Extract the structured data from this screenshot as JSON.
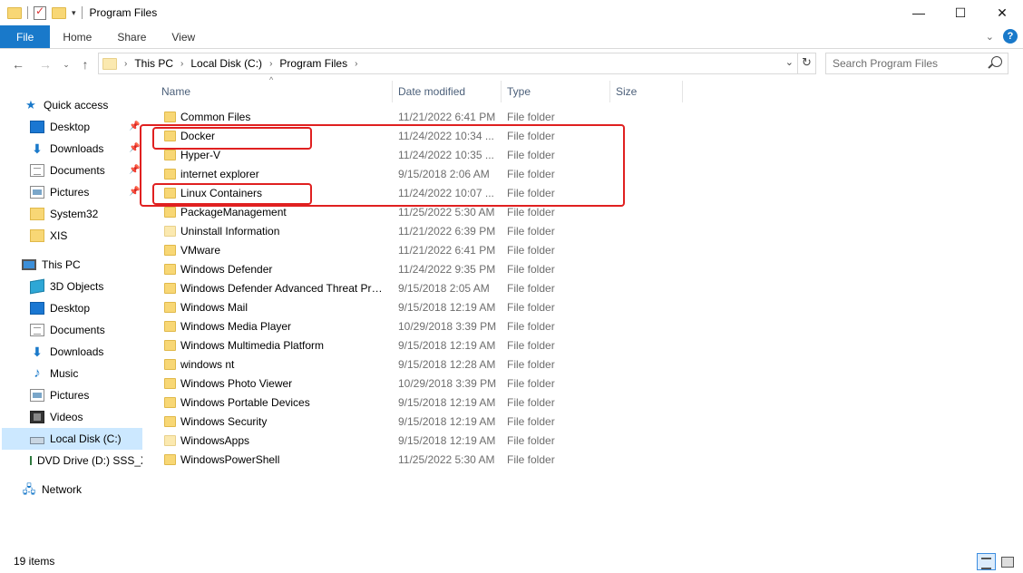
{
  "window": {
    "title": "Program Files",
    "minimize_glyph": "—",
    "maximize_glyph": "☐",
    "close_glyph": "✕"
  },
  "ribbon": {
    "tabs": [
      "File",
      "Home",
      "Share",
      "View"
    ],
    "help_glyph": "?",
    "expand_glyph": "⌄"
  },
  "address": {
    "crumbs": [
      "This PC",
      "Local Disk (C:)",
      "Program Files"
    ],
    "search_placeholder": "Search Program Files"
  },
  "nav": {
    "quick_access": "Quick access",
    "quick_items": [
      "Desktop",
      "Downloads",
      "Documents",
      "Pictures",
      "System32",
      "XIS"
    ],
    "this_pc": "This PC",
    "pc_items": [
      "3D Objects",
      "Desktop",
      "Documents",
      "Downloads",
      "Music",
      "Pictures",
      "Videos",
      "Local Disk (C:)",
      "DVD Drive (D:) SSS_X"
    ],
    "network": "Network"
  },
  "columns": {
    "name": "Name",
    "date": "Date modified",
    "type": "Type",
    "size": "Size"
  },
  "files": [
    {
      "name": "Common Files",
      "date": "11/21/2022 6:41 PM",
      "type": "File folder"
    },
    {
      "name": "Docker",
      "date": "11/24/2022 10:34 ...",
      "type": "File folder"
    },
    {
      "name": "Hyper-V",
      "date": "11/24/2022 10:35 ...",
      "type": "File folder"
    },
    {
      "name": "internet explorer",
      "date": "9/15/2018 2:06 AM",
      "type": "File folder"
    },
    {
      "name": "Linux Containers",
      "date": "11/24/2022 10:07 ...",
      "type": "File folder"
    },
    {
      "name": "PackageManagement",
      "date": "11/25/2022 5:30 AM",
      "type": "File folder"
    },
    {
      "name": "Uninstall Information",
      "date": "11/21/2022 6:39 PM",
      "type": "File folder"
    },
    {
      "name": "VMware",
      "date": "11/21/2022 6:41 PM",
      "type": "File folder"
    },
    {
      "name": "Windows Defender",
      "date": "11/24/2022 9:35 PM",
      "type": "File folder"
    },
    {
      "name": "Windows Defender Advanced Threat Pro...",
      "date": "9/15/2018 2:05 AM",
      "type": "File folder"
    },
    {
      "name": "Windows Mail",
      "date": "9/15/2018 12:19 AM",
      "type": "File folder"
    },
    {
      "name": "Windows Media Player",
      "date": "10/29/2018 3:39 PM",
      "type": "File folder"
    },
    {
      "name": "Windows Multimedia Platform",
      "date": "9/15/2018 12:19 AM",
      "type": "File folder"
    },
    {
      "name": "windows nt",
      "date": "9/15/2018 12:28 AM",
      "type": "File folder"
    },
    {
      "name": "Windows Photo Viewer",
      "date": "10/29/2018 3:39 PM",
      "type": "File folder"
    },
    {
      "name": "Windows Portable Devices",
      "date": "9/15/2018 12:19 AM",
      "type": "File folder"
    },
    {
      "name": "Windows Security",
      "date": "9/15/2018 12:19 AM",
      "type": "File folder"
    },
    {
      "name": "WindowsApps",
      "date": "9/15/2018 12:19 AM",
      "type": "File folder"
    },
    {
      "name": "WindowsPowerShell",
      "date": "11/25/2022 5:30 AM",
      "type": "File folder"
    }
  ],
  "status": {
    "item_count": "19 items"
  },
  "colors": {
    "accent": "#1979ca",
    "highlight": "#e02020",
    "selected_bg": "#cce8ff"
  }
}
